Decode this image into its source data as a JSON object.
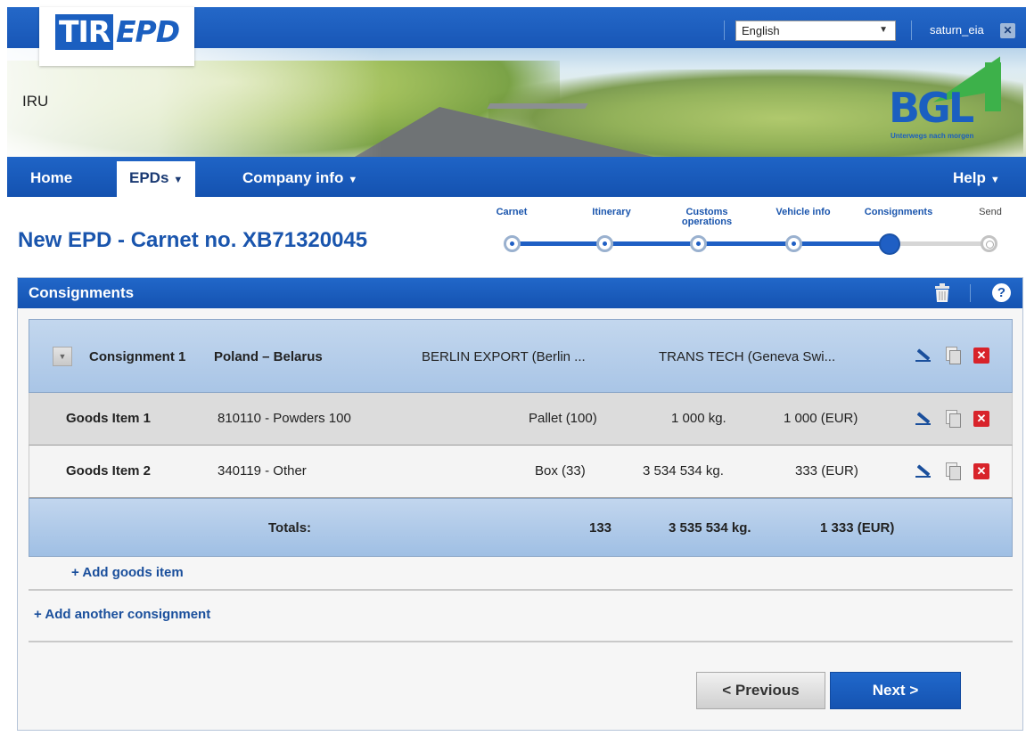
{
  "header": {
    "logo_tir": "TIR",
    "logo_epd": "EPD",
    "org_name": "IRU",
    "language": "English",
    "username": "saturn_eia",
    "bgl_logo": "BGL",
    "bgl_tagline": "Unterwegs nach morgen"
  },
  "nav": {
    "items": [
      {
        "label": "Home"
      },
      {
        "label": "EPDs"
      },
      {
        "label": "Company info"
      },
      {
        "label": "Help"
      }
    ],
    "active": "EPDs"
  },
  "page": {
    "title": "New EPD - Carnet no. XB71320045"
  },
  "stepper": {
    "steps": [
      "Carnet",
      "Itinerary",
      "Customs operations",
      "Vehicle info",
      "Consignments",
      "Send"
    ],
    "current": "Consignments"
  },
  "panel": {
    "title": "Consignments",
    "help": "?"
  },
  "consignment": {
    "name": "Consignment 1",
    "route": "Poland – Belarus",
    "consignor": "BERLIN EXPORT (Berlin ...",
    "consignee": "TRANS TECH (Geneva Swi..."
  },
  "goods_items": [
    {
      "name": "Goods Item 1",
      "code": "810110  - Powders 100",
      "package": "Pallet  (100)",
      "weight": "1 000  kg.",
      "value": "1 000  (EUR)"
    },
    {
      "name": "Goods Item 2",
      "code": "340119  - Other",
      "package": "Box  (33)",
      "weight": "3 534 534  kg.",
      "value": "333  (EUR)"
    }
  ],
  "totals": {
    "label": "Totals:",
    "packages": "133",
    "weight": "3 535 534  kg.",
    "value": "1 333  (EUR)"
  },
  "links": {
    "add_goods_item": "+ Add goods item",
    "add_consignment": "+ Add another consignment"
  },
  "buttons": {
    "previous": "< Previous",
    "next": "Next >"
  },
  "colors": {
    "brand_blue": "#1b5fc0",
    "link_blue": "#1a4f9c",
    "delete_red": "#d8232a",
    "bgl_green": "#3db14a"
  }
}
